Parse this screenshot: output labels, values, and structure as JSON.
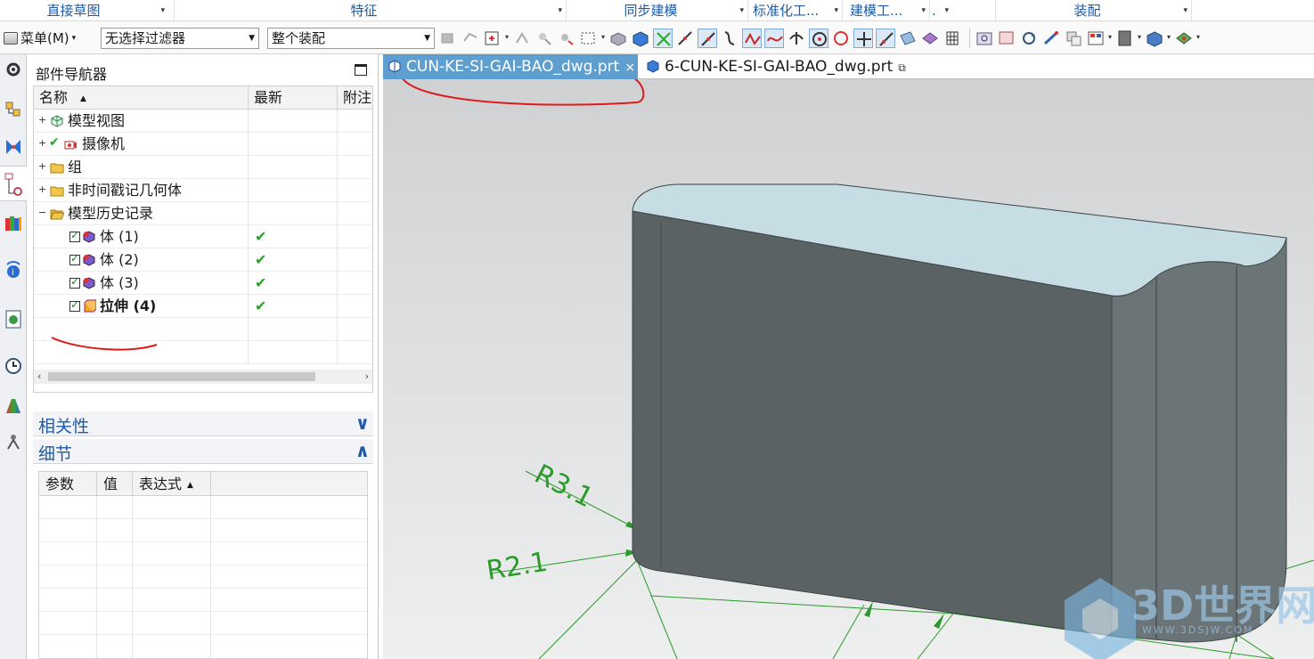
{
  "ribbon_groups": [
    {
      "label": "直接草图"
    },
    {
      "label": "特征"
    },
    {
      "label": "同步建模"
    },
    {
      "label": "标准化工..."
    },
    {
      "label": "建模工..."
    },
    {
      "label": "."
    },
    {
      "label": "装配"
    }
  ],
  "toolbar": {
    "menu_label": "菜单(M)",
    "filter_value": "无选择过滤器",
    "scope_value": "整个装配"
  },
  "navigator": {
    "title": "部件导航器",
    "columns": {
      "name": "名称",
      "latest": "最新",
      "notes": "附注"
    },
    "nodes": [
      {
        "label": "模型视图",
        "expander": "+"
      },
      {
        "label": "摄像机",
        "expander": "+"
      },
      {
        "label": "组",
        "expander": "+"
      },
      {
        "label": "非时间戳记几何体",
        "expander": "+"
      },
      {
        "label": "模型历史记录",
        "expander": "−"
      },
      {
        "label": "体 (1)",
        "latest": "✔"
      },
      {
        "label": "体 (2)",
        "latest": "✔"
      },
      {
        "label": "体 (3)",
        "latest": "✔"
      },
      {
        "label": "拉伸 (4)",
        "latest": "✔"
      }
    ],
    "dependencies_title": "相关性",
    "details_title": "细节",
    "details_columns": {
      "param": "参数",
      "value": "值",
      "expression": "表达式"
    }
  },
  "tabs": [
    {
      "label": "CUN-KE-SI-GAI-BAO_dwg.prt",
      "close": "×"
    },
    {
      "label": "6-CUN-KE-SI-GAI-BAO_dwg.prt"
    }
  ],
  "viewport": {
    "dimensions": [
      "R3.1",
      "R2.1"
    ],
    "watermark": "3D世界网",
    "watermark_url": "WWW.3DSJW.COM"
  },
  "colors": {
    "accent": "#1f5aa6",
    "active_tab": "#5f9fcf",
    "dimension_green": "#2a9a2a",
    "annotation_red": "#e0191b",
    "model_side": "#5a6264",
    "model_top": "#c5dde3"
  }
}
